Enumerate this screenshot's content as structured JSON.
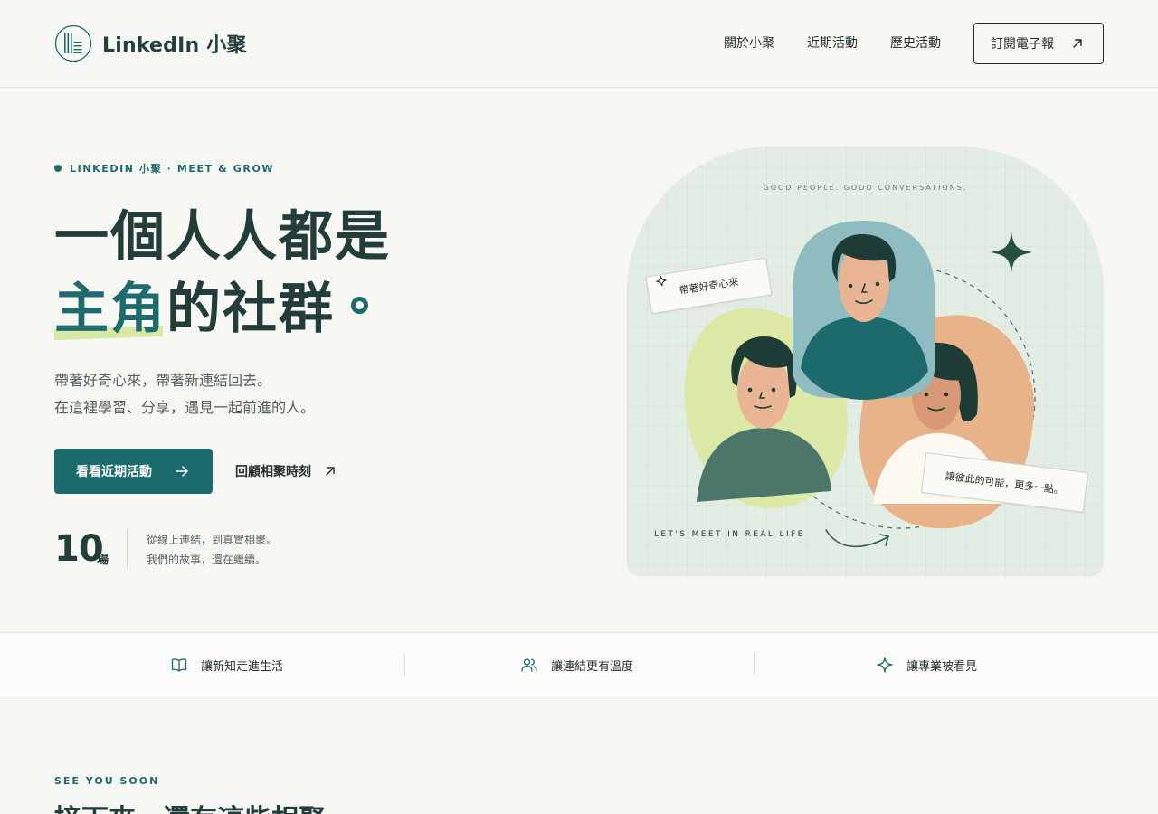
{
  "header": {
    "brand": "LinkedIn 小聚",
    "nav": [
      {
        "label": "關於小聚"
      },
      {
        "label": "近期活動"
      },
      {
        "label": "歷史活動"
      }
    ],
    "subscribe_label": "訂閱電子報"
  },
  "hero": {
    "eyebrow": "LINKEDIN 小聚 · MEET & GROW",
    "title_line1": "一個人人都是",
    "title_accent": "主角",
    "title_line2_rest": "的社群",
    "lead_line1": "帶著好奇心來，帶著新連結回去。",
    "lead_line2": "在這裡學習、分享，遇見一起前進的人。",
    "primary_button": "看看近期活動",
    "secondary_link": "回顧相聚時刻",
    "stat_value": "10",
    "stat_unit": "場",
    "stat_line1": "從線上連結，到真實相聚。",
    "stat_line2": "我們的故事，還在繼續。"
  },
  "illustration": {
    "top_caption": "GOOD PEOPLE. GOOD CONVERSATIONS.",
    "bottom_caption": "LET'S MEET IN REAL LIFE",
    "card_left": "帶著好奇心來",
    "card_right": "讓彼此的可能，更多一點。",
    "colors": {
      "background": "#e4ede3",
      "teal": "#1c6a6b",
      "blue_blob": "#8fbcc0",
      "lime_blob": "#dce8a6",
      "peach_blob": "#e9b38a",
      "skin": "#eab594",
      "hair": "#1f3b36"
    }
  },
  "features": [
    {
      "label": "讓新知走進生活",
      "icon": "book-icon"
    },
    {
      "label": "讓連結更有溫度",
      "icon": "users-icon"
    },
    {
      "label": "讓專業被看見",
      "icon": "sparkle-icon"
    }
  ],
  "next_section": {
    "eyebrow": "SEE YOU SOON",
    "title": "接下來，還有這些相聚"
  },
  "theme": {
    "accent": "#1c6a6b",
    "text_dark": "#233d3b",
    "page_bg": "#f6f7f3"
  }
}
